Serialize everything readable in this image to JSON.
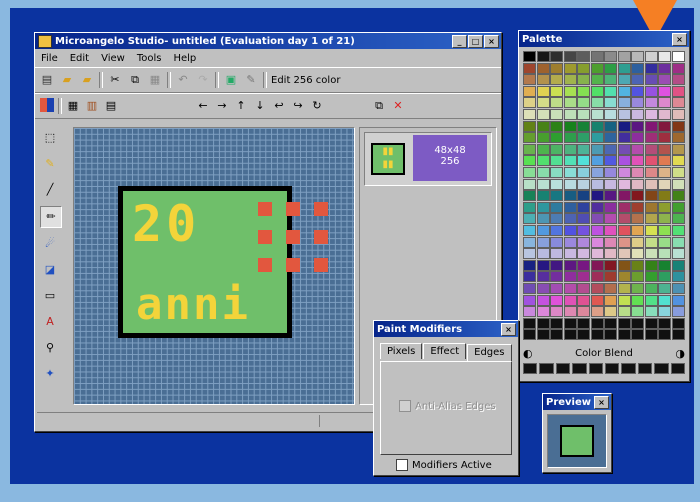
{
  "main_window": {
    "title": "Microangelo Studio- untitled  (Evaluation day 1 of 21)",
    "menu": [
      "File",
      "Edit",
      "View",
      "Tools",
      "Help"
    ],
    "toolbar_label": "Edit 256 color",
    "icon_text_top": "20",
    "icon_text_bottom": "anni",
    "thumbnail": {
      "size": "48x48",
      "colors": "256"
    }
  },
  "palette_window": {
    "title": "Palette",
    "blend_label": "Color Blend"
  },
  "paint_modifiers": {
    "title": "Paint Modifiers",
    "tabs": [
      "Pixels",
      "Effect",
      "Edges"
    ],
    "active_tab": "Edges",
    "option_label": "Anti-Alias Edges",
    "modifiers_active_label": "Modifiers Active"
  },
  "preview_window": {
    "title": "Preview"
  },
  "colors": {
    "desktop": "#0b33a0",
    "canvas_bg": "#4a6e94",
    "icon_green": "#6fbf6a",
    "icon_yellow": "#f3d43a",
    "icon_red": "#e2573e",
    "thumb_purple": "#7d5bc4",
    "arrow": "#f57f24"
  }
}
